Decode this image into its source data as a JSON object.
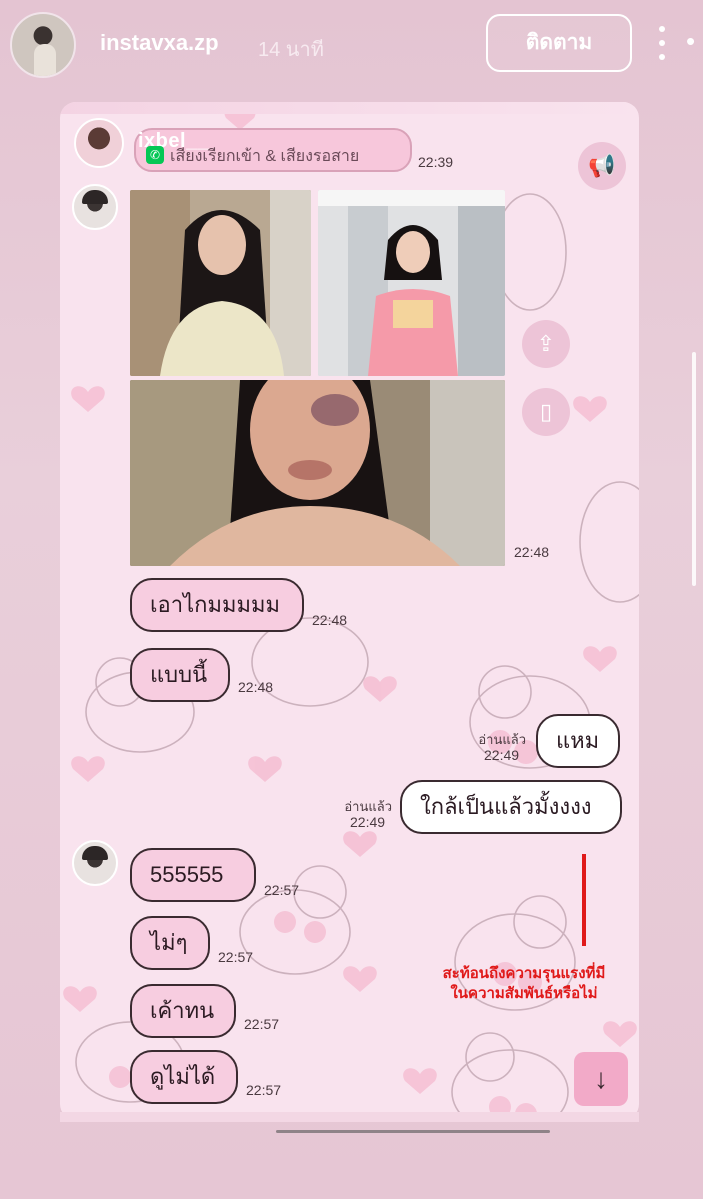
{
  "story": {
    "username": "instavxa.zp",
    "time": "14 นาที",
    "follow_label": "ติดตาม"
  },
  "chat": {
    "call_sender": "ixbel__",
    "call_text": "เสียงเรียกเข้า & เสียงรอสาย",
    "call_time": "22:39",
    "photos_time": "22:48",
    "messages": [
      {
        "text": "เอาไกมมมมม",
        "time": "22:48",
        "direction": "in"
      },
      {
        "text": "แบบนี้",
        "time": "22:48",
        "direction": "in"
      },
      {
        "text": "แหม",
        "time": "22:49",
        "direction": "out",
        "read": "อ่านแล้ว"
      },
      {
        "text": "ใกล้เป็นแล้วมั้งงงง",
        "time": "22:49",
        "direction": "out",
        "read": "อ่านแล้ว"
      },
      {
        "text": "555555",
        "time": "22:57",
        "direction": "in"
      },
      {
        "text": "ไม่ๆ",
        "time": "22:57",
        "direction": "in"
      },
      {
        "text": "เค้าทน",
        "time": "22:57",
        "direction": "in"
      },
      {
        "text": "ดูไม่ได้",
        "time": "22:57",
        "direction": "in"
      }
    ],
    "annotation": "สะท้อนถึงความรุนแรงที่มี\nในความสัมพันธ์หรือไม่",
    "annotation_line1": "สะท้อนถึงความรุนแรงที่มี",
    "annotation_line2": "ในความสัมพันธ์หรือไม่",
    "accent_color": "#e01a1a",
    "bubble_color": "#f7cde0"
  },
  "icons": {
    "more": "more-vertical-icon",
    "close": "close-icon",
    "megaphone": "megaphone-icon",
    "share": "share-icon",
    "gallery": "gallery-icon",
    "scroll_down": "arrow-down-icon"
  }
}
